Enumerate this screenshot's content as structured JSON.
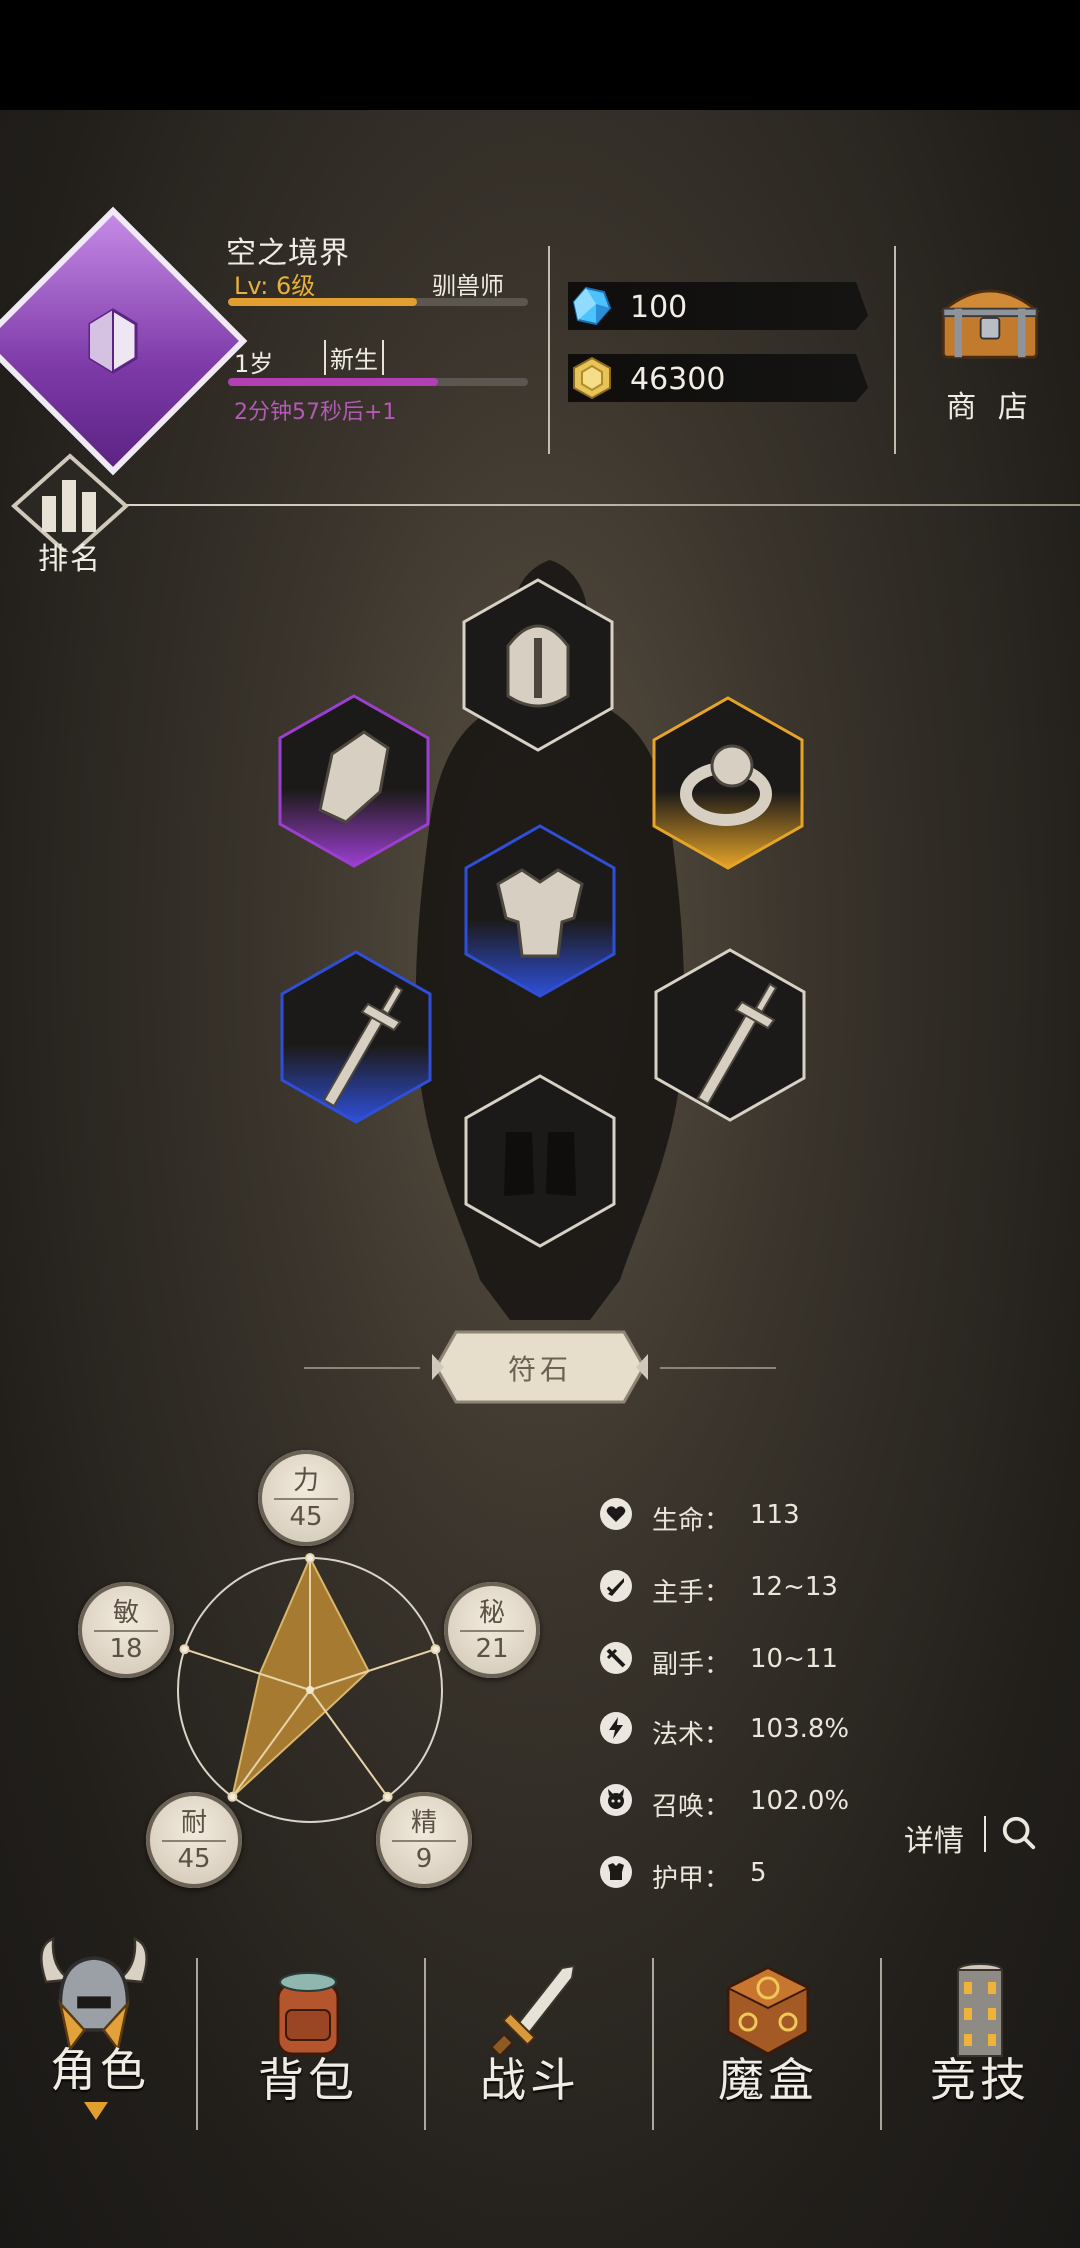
{
  "player": {
    "name": "空之境界",
    "level": "Lv: 6级",
    "job": "驯兽师",
    "exp_progress": 0.63,
    "age": "1岁",
    "age_title": "新生",
    "age_progress": 0.7,
    "age_timer": "2分钟57秒后+1"
  },
  "currency": {
    "gems": "100",
    "gold": "46300"
  },
  "shop": {
    "label": "商 店"
  },
  "ranking": {
    "label": "排名"
  },
  "equipment": {
    "slots": [
      {
        "name": "helmet",
        "rarity": "common"
      },
      {
        "name": "gauntlet",
        "rarity": "epic"
      },
      {
        "name": "ring",
        "rarity": "legendary"
      },
      {
        "name": "armor",
        "rarity": "rare"
      },
      {
        "name": "main-weapon",
        "rarity": "rare"
      },
      {
        "name": "off-weapon",
        "rarity": "common"
      },
      {
        "name": "boots",
        "rarity": "empty"
      }
    ],
    "rarity_colors": {
      "common": "#d8d2c6",
      "epic": "#9b3fd0",
      "legendary": "#e6a428",
      "rare": "#2f4fd8"
    }
  },
  "rune": {
    "label": "符石"
  },
  "attributes": {
    "strength": {
      "name": "力",
      "value": "45"
    },
    "mystic": {
      "name": "秘",
      "value": "21"
    },
    "spirit": {
      "name": "精",
      "value": "9"
    },
    "endurance": {
      "name": "耐",
      "value": "45"
    },
    "agility": {
      "name": "敏",
      "value": "18"
    },
    "radar_fill_color": "#a67a30"
  },
  "stats": [
    {
      "icon": "heart-icon",
      "label": "生命：",
      "value": "113"
    },
    {
      "icon": "sword-icon",
      "label": "主手：",
      "value": "12~13"
    },
    {
      "icon": "offhand-icon",
      "label": "副手：",
      "value": "10~11"
    },
    {
      "icon": "lightning-icon",
      "label": "法术：",
      "value": "103.8%"
    },
    {
      "icon": "summon-icon",
      "label": "召唤：",
      "value": "102.0%"
    },
    {
      "icon": "armor-icon",
      "label": "护甲：",
      "value": "5"
    }
  ],
  "details": {
    "label": "详情"
  },
  "nav": [
    {
      "label": "角色",
      "icon": "viking-helmet-icon",
      "active": true
    },
    {
      "label": "背包",
      "icon": "backpack-icon",
      "active": false
    },
    {
      "label": "战斗",
      "icon": "sword-icon",
      "active": false
    },
    {
      "label": "魔盒",
      "icon": "magic-box-icon",
      "active": false
    },
    {
      "label": "竞技",
      "icon": "tower-icon",
      "active": false
    }
  ]
}
